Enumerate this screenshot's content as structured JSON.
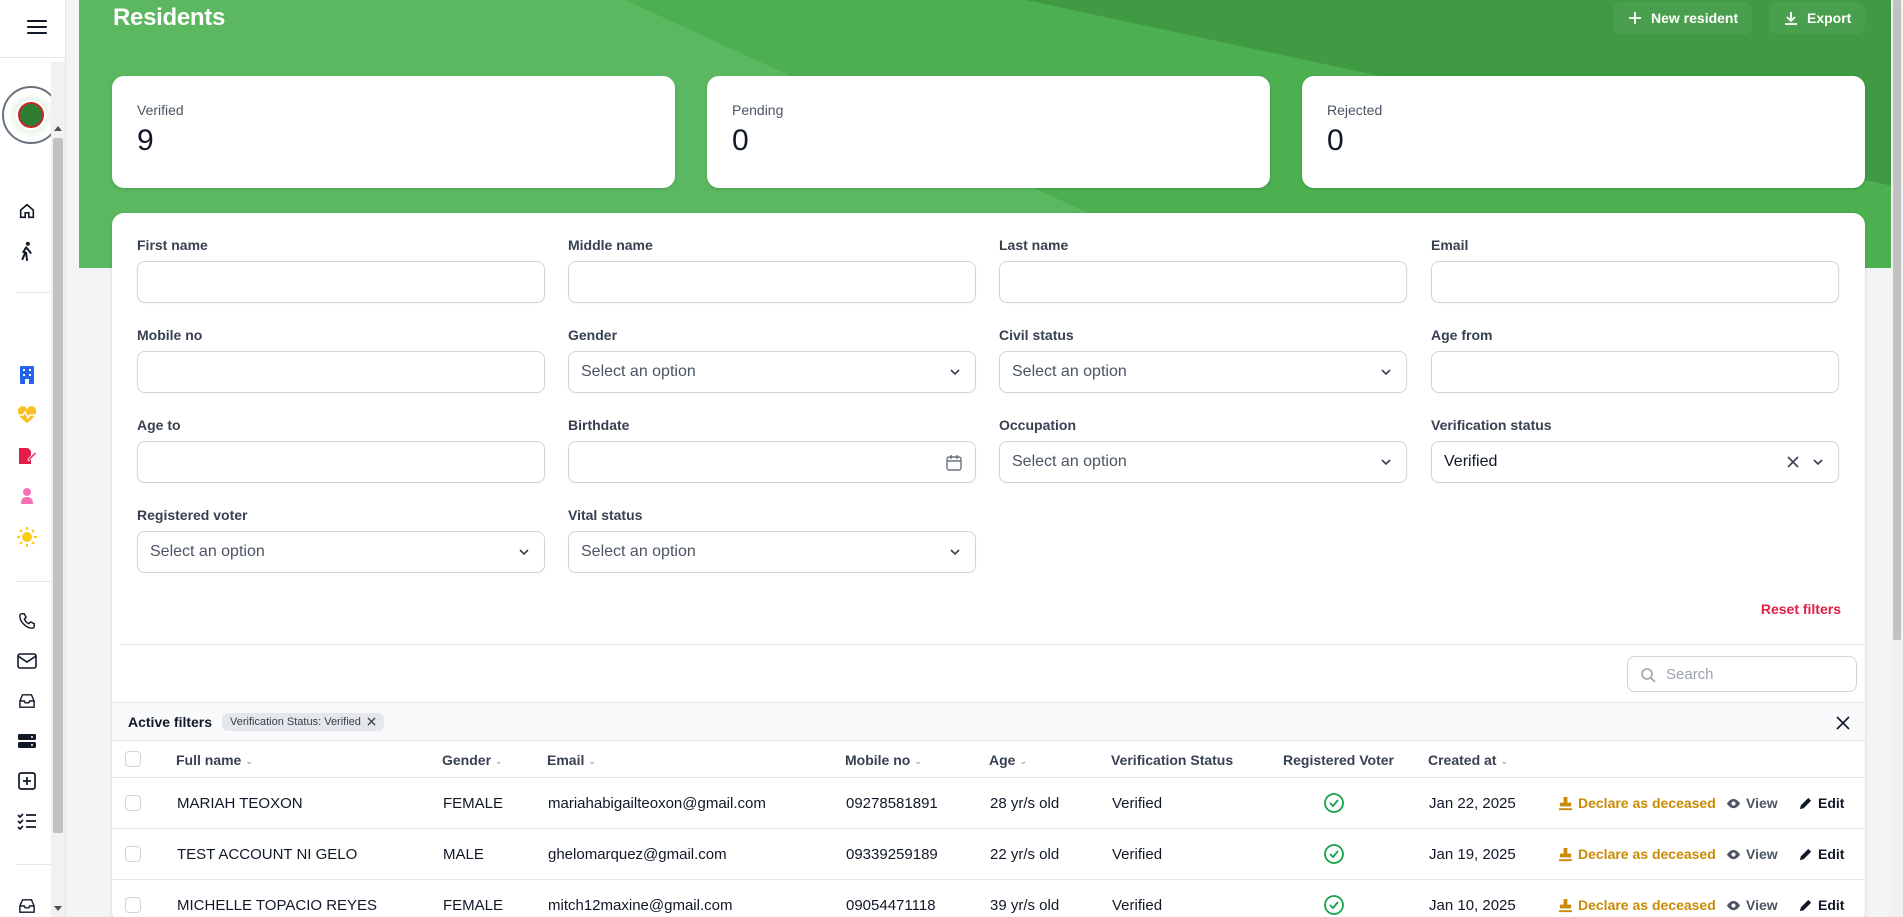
{
  "header": {
    "title": "Residents",
    "new_resident_label": "New resident",
    "export_label": "Export"
  },
  "stats": [
    {
      "label": "Verified",
      "value": "9"
    },
    {
      "label": "Pending",
      "value": "0"
    },
    {
      "label": "Rejected",
      "value": "0"
    }
  ],
  "filters": {
    "first_name": {
      "label": "First name",
      "value": ""
    },
    "middle_name": {
      "label": "Middle name",
      "value": ""
    },
    "last_name": {
      "label": "Last name",
      "value": ""
    },
    "email": {
      "label": "Email",
      "value": ""
    },
    "mobile_no": {
      "label": "Mobile no",
      "value": ""
    },
    "gender": {
      "label": "Gender",
      "value": "Select an option"
    },
    "civil_status": {
      "label": "Civil status",
      "value": "Select an option"
    },
    "age_from": {
      "label": "Age from",
      "value": ""
    },
    "age_to": {
      "label": "Age to",
      "value": ""
    },
    "birthdate": {
      "label": "Birthdate",
      "value": ""
    },
    "occupation": {
      "label": "Occupation",
      "value": "Select an option"
    },
    "verification_status": {
      "label": "Verification status",
      "value": "Verified"
    },
    "registered_voter": {
      "label": "Registered voter",
      "value": "Select an option"
    },
    "vital_status": {
      "label": "Vital status",
      "value": "Select an option"
    },
    "reset_label": "Reset filters"
  },
  "search": {
    "placeholder": "Search"
  },
  "active_filters": {
    "label": "Active filters",
    "chips": [
      "Verification Status: Verified"
    ]
  },
  "table": {
    "columns": [
      "Full name",
      "Gender",
      "Email",
      "Mobile no",
      "Age",
      "Verification Status",
      "Registered Voter",
      "Created at"
    ],
    "actions": {
      "deceased": "Declare as deceased",
      "view": "View",
      "edit": "Edit"
    },
    "rows": [
      {
        "full_name": "MARIAH TEOXON",
        "gender": "FEMALE",
        "email": "mariahabigailteoxon@gmail.com",
        "mobile": "09278581891",
        "age": "28 yr/s old",
        "status": "Verified",
        "voter": true,
        "created": "Jan 22, 2025"
      },
      {
        "full_name": "TEST ACCOUNT NI GELO",
        "gender": "MALE",
        "email": "ghelomarquez@gmail.com",
        "mobile": "09339259189",
        "age": "22 yr/s old",
        "status": "Verified",
        "voter": true,
        "created": "Jan 19, 2025"
      },
      {
        "full_name": "MICHELLE TOPACIO REYES",
        "gender": "FEMALE",
        "email": "mitch12maxine@gmail.com",
        "mobile": "09054471118",
        "age": "39 yr/s old",
        "status": "Verified",
        "voter": true,
        "created": "Jan 10, 2025"
      }
    ]
  },
  "sidebar": {
    "icons": [
      "menu-icon",
      "seal-logo",
      "home-icon",
      "walking-person-icon",
      "building-icon",
      "heart-pulse-icon",
      "document-edit-icon",
      "baby-icon",
      "sun-icon",
      "phone-icon",
      "mail-icon",
      "inbox-icon",
      "server-icon",
      "plus-square-icon",
      "checklist-icon",
      "inbox-icon-2"
    ]
  },
  "colors": {
    "brand_green": "#4caf50",
    "danger": "#e11d48",
    "warning": "#ca8a04",
    "success": "#16a34a"
  }
}
